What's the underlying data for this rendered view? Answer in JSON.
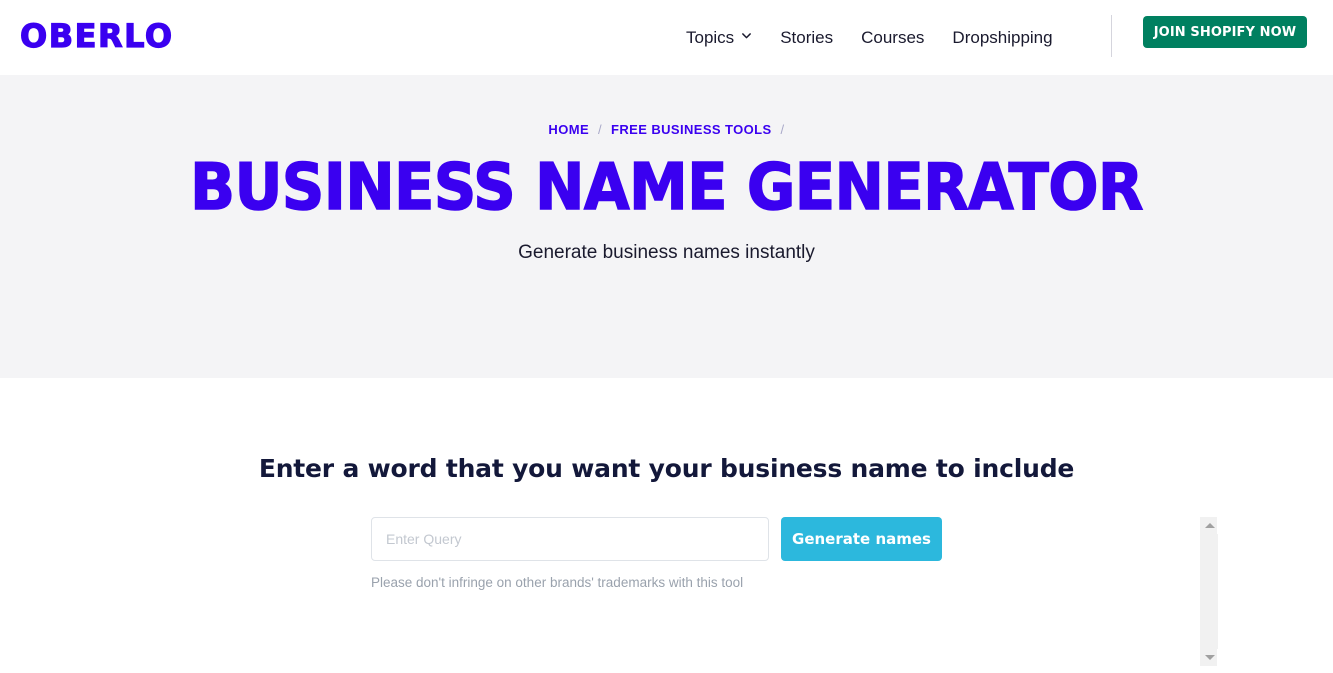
{
  "header": {
    "logo_text": "OBERLO",
    "nav_items": [
      {
        "label": "Topics",
        "has_dropdown": true,
        "icon": "chevron-down-icon"
      },
      {
        "label": "Stories",
        "has_dropdown": false
      },
      {
        "label": "Courses",
        "has_dropdown": false
      },
      {
        "label": "Dropshipping",
        "has_dropdown": false
      }
    ],
    "cta_label": "JOIN SHOPIFY NOW",
    "cta_color": "#008060"
  },
  "hero": {
    "breadcrumb": {
      "items": [
        {
          "label": "HOME"
        },
        {
          "label": "FREE BUSINESS TOOLS"
        }
      ],
      "separator": "/",
      "trailing_separator": "/"
    },
    "title": "BUSINESS NAME GENERATOR",
    "subtitle": "Generate business names instantly",
    "background_color": "#f4f4f6",
    "accent_color": "#3a00f0"
  },
  "tool": {
    "heading": "Enter a word that you want your business name to include",
    "input": {
      "placeholder": "Enter Query",
      "value": ""
    },
    "submit_label": "Generate names",
    "submit_color": "#2cb8dd",
    "disclaimer": "Please don't infringe on other brands' trademarks with this tool"
  },
  "scrollbar": {
    "up_arrow_icon": "triangle-up-icon",
    "down_arrow_icon": "triangle-down-icon"
  }
}
